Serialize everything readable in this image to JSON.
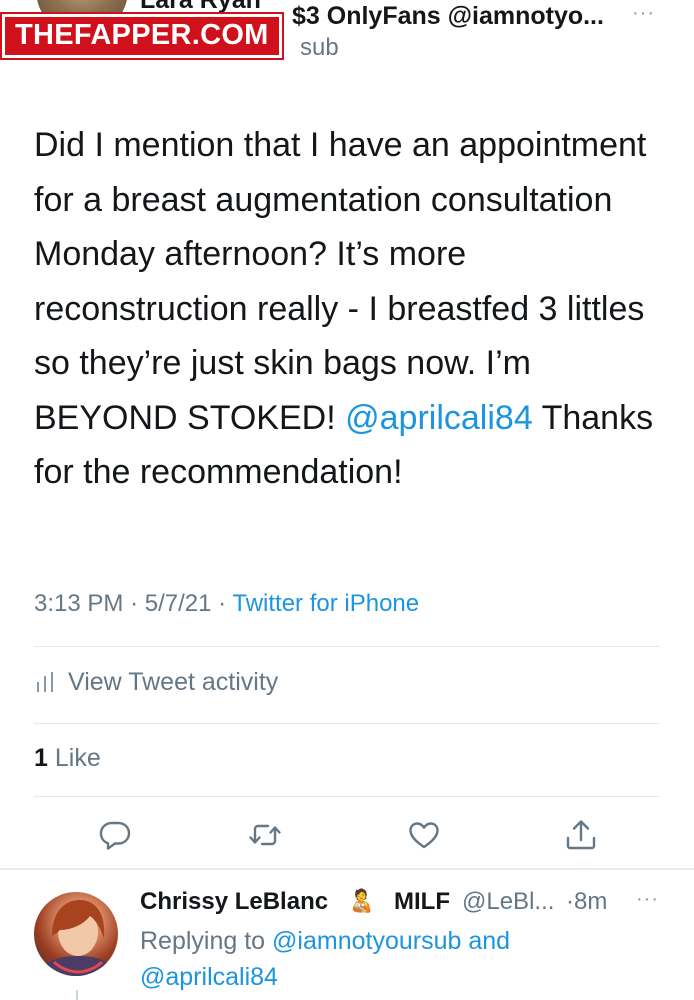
{
  "header": {
    "author_name": "Lara Ryan",
    "author_name_rest": "$3 OnlyFans @iamnotyo...",
    "handle_suffix": "sub",
    "more": "···"
  },
  "watermark": "THEFAPPER.COM",
  "tweet": {
    "text_before_mention": "Did I mention that I have an appointment for a breast augmentation consultation Monday afternoon? It’s more reconstruction really - I breastfed 3 littles so they’re just skin bags now. I’m BEYOND STOKED! ",
    "mention": "@aprilcali84",
    "text_after_mention": " Thanks for the recommendation!",
    "time": "3:13 PM",
    "date": "5/7/21",
    "separator": "·",
    "source": "Twitter for iPhone"
  },
  "activity": {
    "label": "View Tweet activity",
    "icon": "bar-chart-icon"
  },
  "likes": {
    "count": "1",
    "label": "Like"
  },
  "actions": [
    {
      "icon": "reply-icon"
    },
    {
      "icon": "retweet-icon"
    },
    {
      "icon": "like-heart-icon"
    },
    {
      "icon": "share-icon"
    }
  ],
  "reply": {
    "name": "Chrissy LeBlanc",
    "emoji": "🧑‍🍼",
    "tag": "MILF",
    "handle": "@LeBl...",
    "time": "·8m",
    "more": "···",
    "replying_to_label": "Replying to",
    "replying_to_user1": "@iamnotyoursub",
    "and": "and",
    "replying_to_user2": "@aprilcali84"
  },
  "colors": {
    "link": "#1b95e0",
    "secondary_text": "#657786",
    "watermark_bg": "#d0101a"
  }
}
